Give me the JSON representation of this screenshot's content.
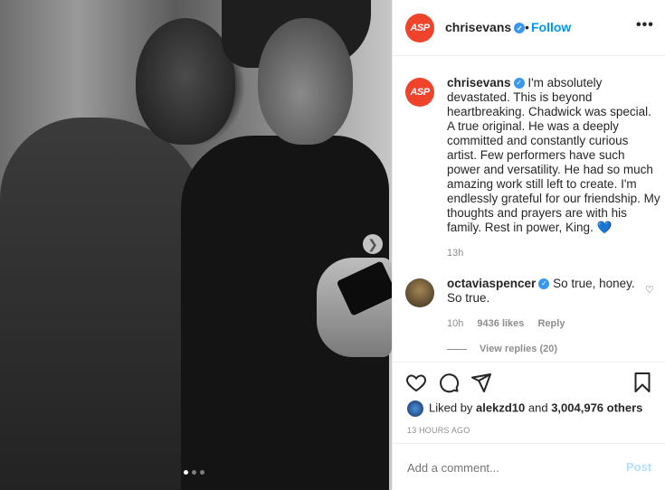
{
  "post": {
    "username": "chrisevans",
    "follow_label": "Follow",
    "more_label": "•••",
    "avatar_text": "ASP",
    "photo_dots": {
      "count": 3,
      "active_index": 0
    }
  },
  "caption": {
    "username": "chrisevans",
    "text": "I'm absolutely devastated. This is beyond heartbreaking. Chadwick was special. A true original. He was a deeply committed and constantly curious artist. Few performers have such power and versatility. He had so much amazing work still left to create. I'm endlessly grateful for our friendship. My thoughts and prayers are with his family. Rest in power, King.",
    "emoji": "💙",
    "time": "13h"
  },
  "comment": {
    "username": "octaviaspencer",
    "text": "So true, honey. So true.",
    "time": "10h",
    "likes": "9436 likes",
    "reply_label": "Reply",
    "view_replies": "View replies (20)"
  },
  "likes": {
    "prefix": "Liked by",
    "user": "alekzd10",
    "middle": "and",
    "others": "3,004,976 others"
  },
  "timestamp": "13 HOURS AGO",
  "add_comment": {
    "placeholder": "Add a comment...",
    "post_label": "Post"
  },
  "colors": {
    "accent": "#0095f6",
    "verified": "#3897f0",
    "avatar": "#f0432c"
  },
  "icons": [
    "heart-icon",
    "comment-icon",
    "share-icon",
    "bookmark-icon",
    "more-icon",
    "verified-icon",
    "next-arrow-icon"
  ]
}
